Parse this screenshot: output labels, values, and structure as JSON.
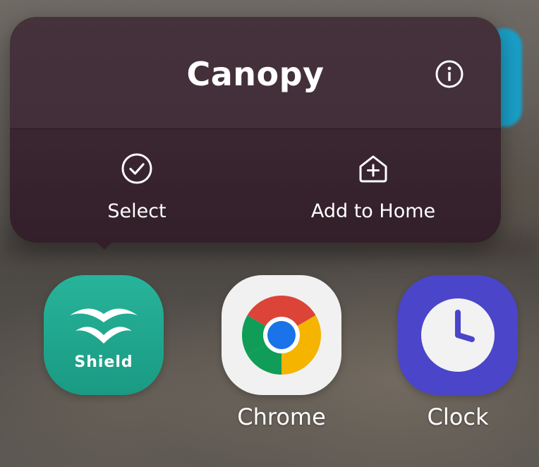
{
  "popup": {
    "title": "Canopy",
    "info_icon": "info-icon",
    "actions": [
      {
        "label": "Select",
        "icon": "check-circle-icon"
      },
      {
        "label": "Add to Home",
        "icon": "add-home-icon"
      }
    ]
  },
  "apps": [
    {
      "label": "",
      "icon_text": "Shield",
      "icon": "shield-app-icon",
      "color": "#1a9a83"
    },
    {
      "label": "Chrome",
      "icon": "chrome-icon",
      "color": "#f1f1f1"
    },
    {
      "label": "Clock",
      "icon": "clock-icon",
      "color": "#4a45c9"
    }
  ],
  "colors": {
    "popup_bg": "#3a2630",
    "text": "#ffffff"
  }
}
